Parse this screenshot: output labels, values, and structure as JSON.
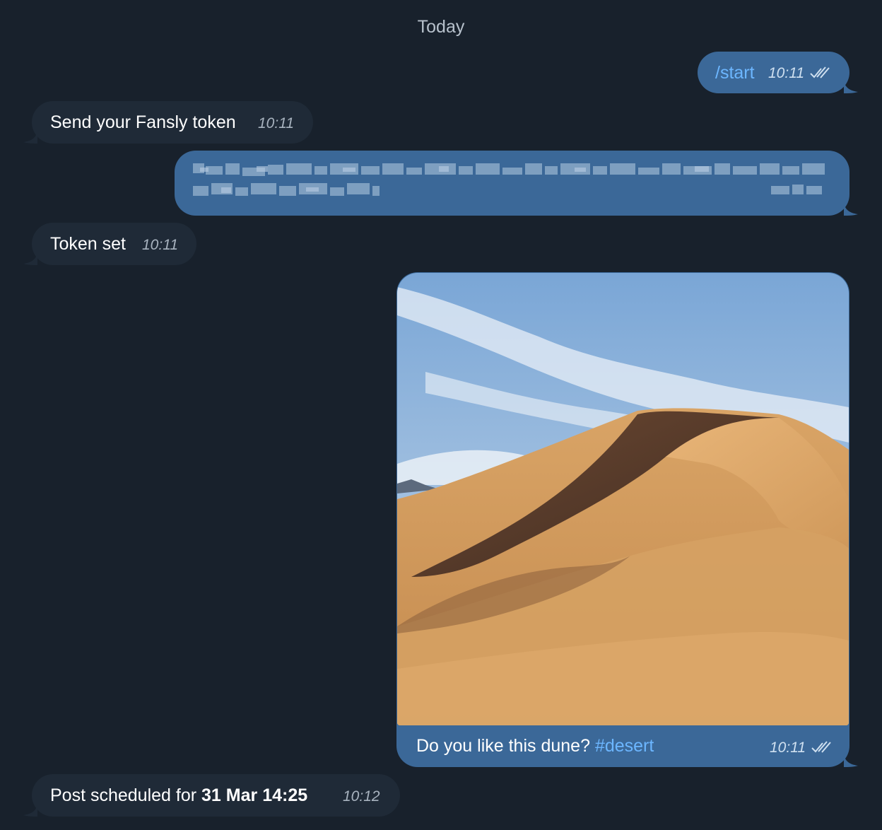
{
  "chat": {
    "day_separator": "Today",
    "messages": [
      {
        "id": "m1",
        "direction": "out",
        "text": "/start",
        "time": "10:11",
        "read": true
      },
      {
        "id": "m2",
        "direction": "in",
        "text": "Send your Fansly token",
        "time": "10:11"
      },
      {
        "id": "m3",
        "direction": "out",
        "text_redacted": true,
        "read": true
      },
      {
        "id": "m4",
        "direction": "in",
        "text": "Token set",
        "time": "10:11"
      },
      {
        "id": "m5",
        "direction": "out",
        "media": "photo",
        "caption": "Do you like this dune?",
        "hashtag": "#desert",
        "time": "10:11",
        "read": true
      },
      {
        "id": "m6",
        "direction": "in",
        "text_prefix": "Post scheduled for",
        "text_bold": "31 Mar 14:25",
        "time": "10:12"
      }
    ]
  },
  "icons": {
    "read_receipt": "double-check-icon"
  },
  "colors": {
    "background": "#18212c",
    "incoming_bubble": "#1f2a37",
    "outgoing_bubble": "#3b6898",
    "link": "#6cb6ff",
    "timestamp_incoming": "#a8b3bf"
  }
}
